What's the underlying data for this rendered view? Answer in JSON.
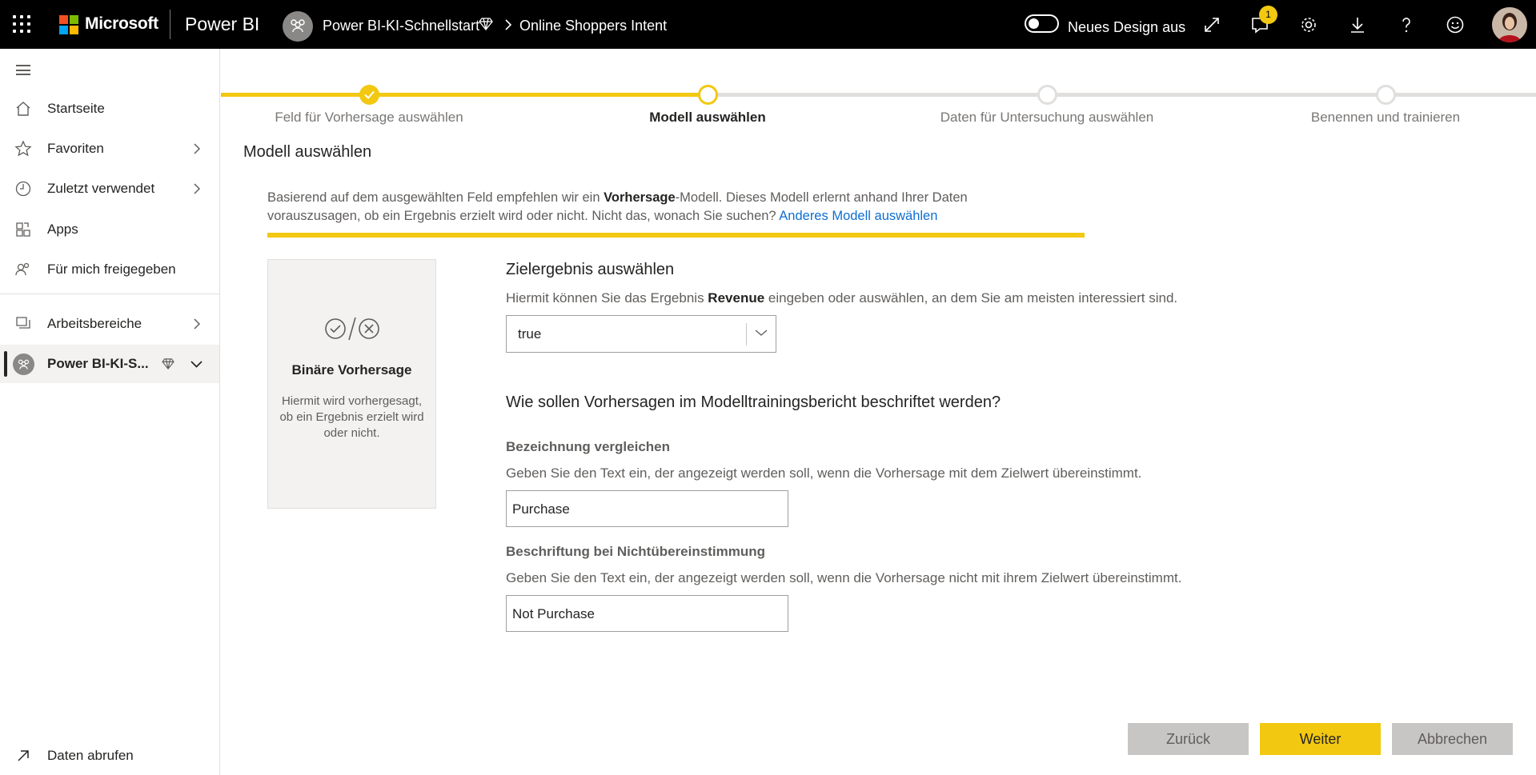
{
  "topbar": {
    "brand": "Microsoft",
    "product": "Power BI",
    "workspace": "Power BI-KI-Schnellstart",
    "report": "Online Shoppers Intent",
    "toggle_label": "Neues Design aus",
    "notification_count": "1",
    "icons": [
      "app-launcher-icon",
      "microsoft-logo",
      "workspace-icon",
      "premium-diamond-icon",
      "chevron-right-icon",
      "expand-icon",
      "notifications-icon",
      "settings-icon",
      "download-icon",
      "help-icon",
      "feedback-smiley-icon",
      "user-avatar"
    ]
  },
  "sidebar": {
    "items": [
      {
        "label": "Startseite",
        "icon": "home-icon"
      },
      {
        "label": "Favoriten",
        "icon": "star-icon"
      },
      {
        "label": "Zuletzt verwendet",
        "icon": "clock-icon"
      },
      {
        "label": "Apps",
        "icon": "apps-icon"
      },
      {
        "label": "Für mich freigegeben",
        "icon": "shared-people-icon"
      },
      {
        "label": "Arbeitsbereiche",
        "icon": "workspaces-icon"
      },
      {
        "label": "Power BI-KI-S...",
        "icon": "workspace-icon"
      }
    ],
    "footer": "Daten abrufen"
  },
  "wizard": {
    "steps": [
      "Feld für Vorhersage auswählen",
      "Modell auswählen",
      "Daten für Untersuchung auswählen",
      "Benennen und trainieren"
    ],
    "current_step": 2,
    "title": "Modell auswählen",
    "desc_part1": "Basierend auf dem ausgewählten Feld empfehlen wir ein ",
    "desc_bold": "Vorhersage",
    "desc_part2": "-Modell. Dieses Modell erlernt anhand Ihrer Daten vorauszusagen, ob ein Ergebnis erzielt wird oder nicht. Nicht das, wonach Sie suchen? ",
    "desc_link": "Anderes Modell auswählen",
    "card": {
      "title": "Binäre Vorhersage",
      "description": "Hiermit wird vorhergesagt, ob ein Ergebnis erzielt wird oder nicht.",
      "icon": "check-slash-x-icon"
    },
    "target": {
      "heading": "Zielergebnis auswählen",
      "text_before": "Hiermit können Sie das Ergebnis ",
      "text_bold": "Revenue",
      "text_after": " eingeben oder auswählen, an dem Sie am meisten interessiert sind.",
      "selected": "true"
    },
    "labels": {
      "heading": "Wie sollen Vorhersagen im Modelltrainingsbericht beschriftet werden?",
      "match_heading": "Bezeichnung vergleichen",
      "match_text": "Geben Sie den Text ein, der angezeigt werden soll, wenn die Vorhersage mit dem Zielwert übereinstimmt.",
      "match_value": "Purchase",
      "nomatch_heading": "Beschriftung bei Nichtübereinstimmung",
      "nomatch_text": "Geben Sie den Text ein, der angezeigt werden soll, wenn die Vorhersage nicht mit ihrem Zielwert übereinstimmt.",
      "nomatch_value": "Not Purchase"
    },
    "buttons": {
      "back": "Zurück",
      "next": "Weiter",
      "cancel": "Abbrechen"
    }
  },
  "colors": {
    "accent": "#F2C811",
    "link": "#0E6ED1",
    "topbar": "#000000"
  }
}
